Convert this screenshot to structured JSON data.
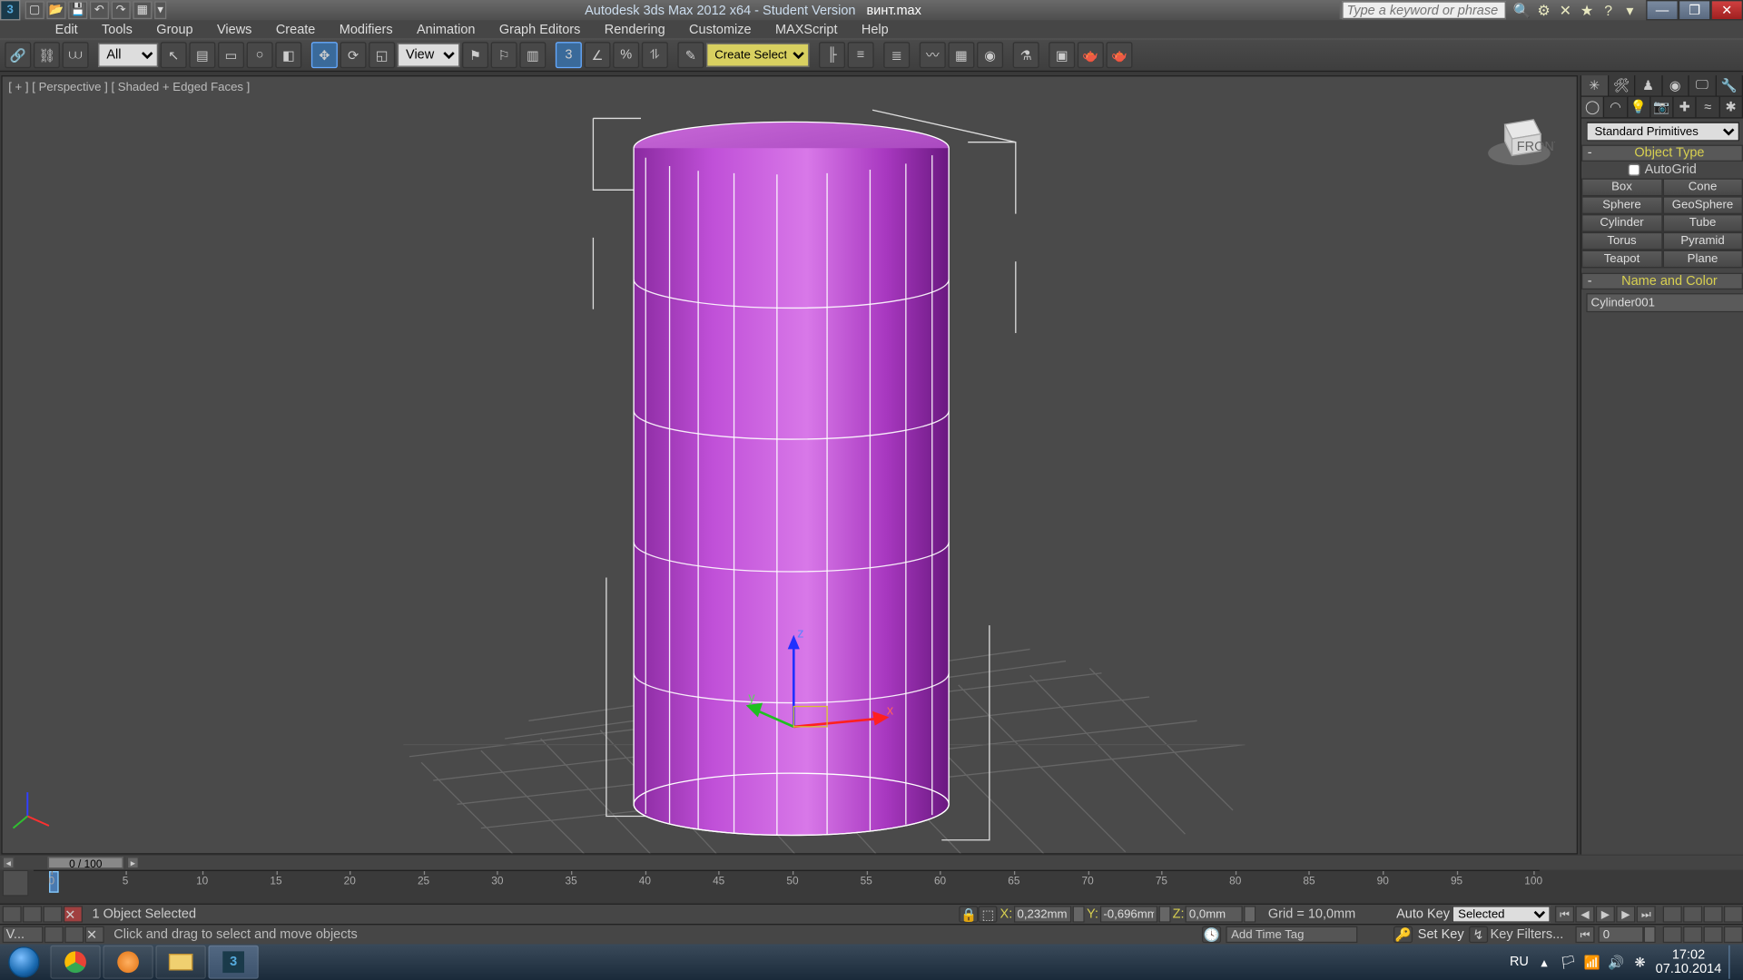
{
  "title": {
    "app": "Autodesk 3ds Max  2012 x64 ",
    "edition": "- Student Version",
    "file": "винт.max"
  },
  "qat": [
    "new",
    "open",
    "save",
    "undo",
    "redo",
    "project"
  ],
  "search_placeholder": "Type a keyword or phrase",
  "menus": [
    "Edit",
    "Tools",
    "Group",
    "Views",
    "Create",
    "Modifiers",
    "Animation",
    "Graph Editors",
    "Rendering",
    "Customize",
    "MAXScript",
    "Help"
  ],
  "toolbar": {
    "filter": "All",
    "view": "View",
    "namedsel": "Create Selection Se"
  },
  "viewport": {
    "label": "[ + ] [ Perspective ] [ Shaded + Edged Faces ]"
  },
  "panel": {
    "category": "Standard Primitives",
    "objtype_hdr": "Object Type",
    "autogrid": "AutoGrid",
    "buttons": [
      [
        "Box",
        "Cone"
      ],
      [
        "Sphere",
        "GeoSphere"
      ],
      [
        "Cylinder",
        "Tube"
      ],
      [
        "Torus",
        "Pyramid"
      ],
      [
        "Teapot",
        "Plane"
      ]
    ],
    "namecolor_hdr": "Name and Color",
    "objname": "Cylinder001"
  },
  "timeline": {
    "frame_label": "0 / 100",
    "ticks": [
      0,
      5,
      10,
      15,
      20,
      25,
      30,
      35,
      40,
      45,
      50,
      55,
      60,
      65,
      70,
      75,
      80,
      85,
      90,
      95,
      100
    ]
  },
  "status": {
    "selection": "1 Object Selected",
    "hint": "Click and drag to select and move objects",
    "x_lbl": "X:",
    "x": "0,232mm",
    "y_lbl": "Y:",
    "y": "-0,696mm",
    "z_lbl": "Z:",
    "z": "0,0mm",
    "grid": "Grid = 10,0mm",
    "autokey": "Auto Key",
    "setkey": "Set Key",
    "keymode": "Selected",
    "keyfilters": "Key Filters...",
    "addtag": "Add Time Tag",
    "frame": "0",
    "tabname": "V..."
  },
  "taskbar": {
    "lang": "RU",
    "time": "17:02",
    "date": "07.10.2014"
  }
}
